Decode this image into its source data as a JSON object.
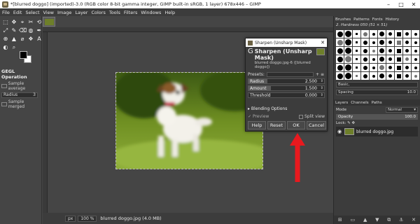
{
  "window": {
    "title": "*[blurred doggo] (imported)-3.0 (RGB color 8-bit gamma integer, GIMP built-in sRGB, 1 layer) 678x446 – GIMP",
    "minimize": "–",
    "maximize": "□",
    "close": "✕"
  },
  "menubar": [
    "File",
    "Edit",
    "Select",
    "View",
    "Image",
    "Layer",
    "Colors",
    "Tools",
    "Filters",
    "Windows",
    "Help"
  ],
  "toolbox": {
    "tools": [
      "⬚",
      "✥",
      "⌖",
      "✂",
      "⟲",
      "⤢",
      "✎",
      "⌫",
      "◍",
      "✒",
      "⊕",
      "▲",
      "⌀",
      "❖",
      "A",
      "◐",
      "⌕"
    ],
    "options_title": "GEGL Operation",
    "sample_average": "Sample average",
    "radius_label": "Radius",
    "radius_value": "3",
    "sample_merged": "Sample merged"
  },
  "dialog": {
    "title": "Sharpen (Unsharp Mask)",
    "heading": "Sharpen (Unsharp Mask)",
    "subheading": "blurred doggo.jpg-6 ([blurred doggo])",
    "presets_label": "Presets:",
    "sliders": [
      {
        "label": "Radius",
        "value": "2.500",
        "fraction": 0.25
      },
      {
        "label": "Amount",
        "value": "1.500",
        "fraction": 0.3
      },
      {
        "label": "Threshold",
        "value": "0.000",
        "fraction": 0.0
      }
    ],
    "blending_options": "Blending Options",
    "preview": "Preview",
    "split_view": "Split view",
    "buttons": {
      "help": "Help",
      "reset": "Reset",
      "ok": "OK",
      "cancel": "Cancel"
    }
  },
  "statusbar": {
    "unit": "px",
    "zoom": "100 %",
    "info": "blurred doggo.jpg (4.0 MB)"
  },
  "dock": {
    "tabs": [
      "Brushes",
      "Patterns",
      "Fonts",
      "History"
    ],
    "brush_name": "2. Hardness 050 (51 × 51)",
    "brush_filter": "Basic,",
    "spacing_label": "Spacing",
    "spacing_value": "10.0",
    "layer_tabs": [
      "Layers",
      "Channels",
      "Paths"
    ],
    "mode_label": "Mode",
    "mode_value": "Normal",
    "opacity_label": "Opacity",
    "opacity_value": "100.0",
    "opacity_fraction": 1.0,
    "lock_label": "Lock:",
    "layer_name": "blurred doggo.jpg"
  },
  "colors": {
    "arrow": "#e8191e"
  }
}
